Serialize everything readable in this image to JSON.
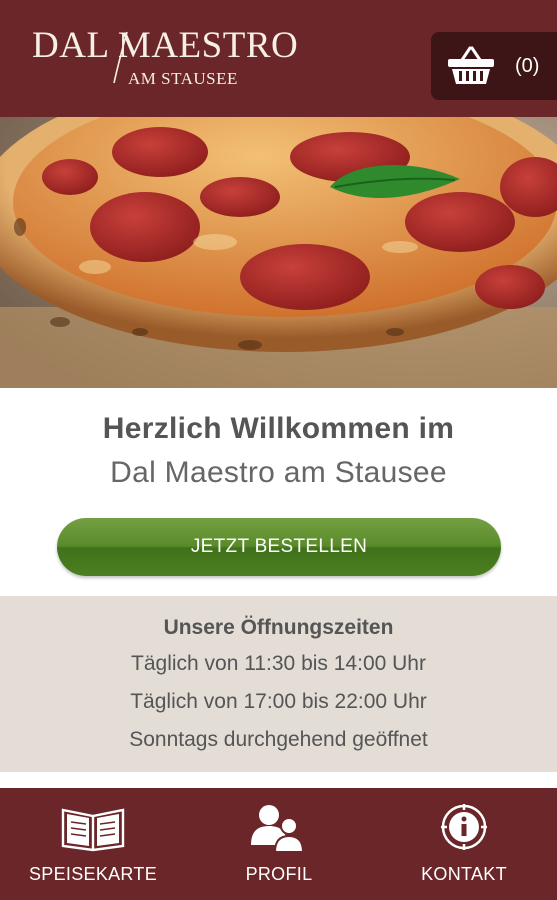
{
  "header": {
    "logo_main": "DAL MAESTRO",
    "logo_sub": "AM STAUSEE",
    "cart_count": "(0)"
  },
  "hero": {
    "image": "pizza-photo"
  },
  "welcome": {
    "title": "Herzlich Willkommen im",
    "subtitle": "Dal Maestro am Stausee",
    "order_button": "JETZT BESTELLEN"
  },
  "hours": {
    "title": "Unsere Öffnungszeiten",
    "lines": [
      "Täglich von 11:30 bis 14:00 Uhr",
      "Täglich von 17:00 bis 22:00 Uhr",
      "Sonntags durchgehend geöffnet"
    ]
  },
  "nav": {
    "items": [
      {
        "label": "SPEISEKARTE",
        "icon": "open-book-icon"
      },
      {
        "label": "PROFIL",
        "icon": "users-icon"
      },
      {
        "label": "KONTAKT",
        "icon": "info-icon"
      }
    ]
  },
  "colors": {
    "brand": "#6a2628",
    "cart_bg": "#3e1516",
    "button_green": "#4f8324",
    "hours_bg": "#e3ddd6"
  }
}
